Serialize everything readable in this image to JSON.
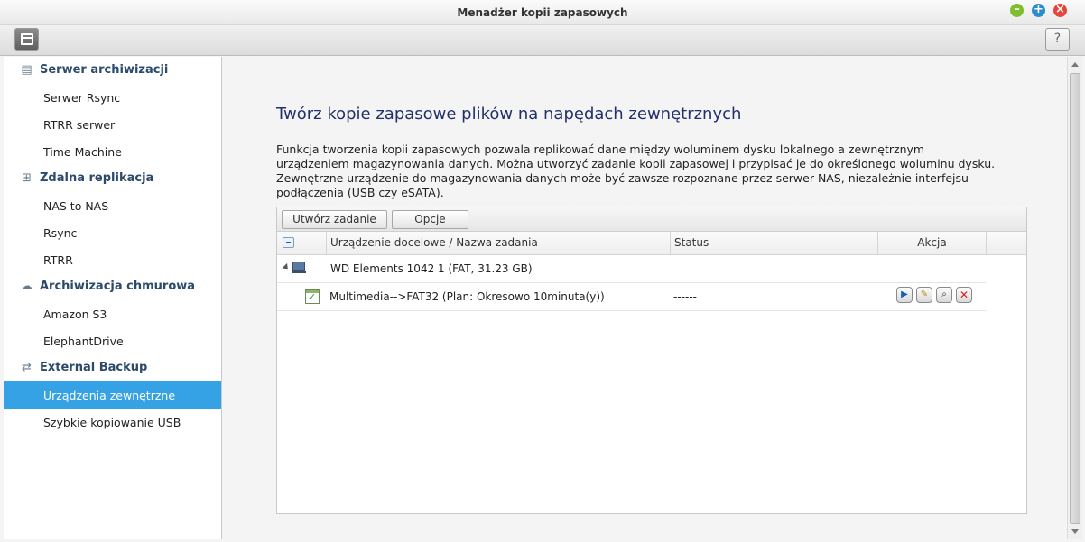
{
  "window": {
    "title": "Menadżer kopii zapasowych"
  },
  "toolbar": {
    "help_label": "?"
  },
  "sidebar": {
    "sections": [
      {
        "label": "Serwer archiwizacji",
        "icon": "server-icon",
        "items": [
          "Serwer Rsync",
          "RTRR serwer",
          "Time Machine"
        ]
      },
      {
        "label": "Zdalna replikacja",
        "icon": "replication-icon",
        "items": [
          "NAS to NAS",
          "Rsync",
          "RTRR"
        ]
      },
      {
        "label": "Archiwizacja chmurowa",
        "icon": "cloud-icon",
        "items": [
          "Amazon S3",
          "ElephantDrive"
        ]
      },
      {
        "label": "External Backup",
        "icon": "sync-icon",
        "items": [
          "Urządzenia zewnętrzne",
          "Szybkie kopiowanie USB"
        ]
      }
    ],
    "active_item": "Urządzenia zewnętrzne"
  },
  "main": {
    "heading": "Twórz kopie zapasowe plików na napędach zewnętrznych",
    "description": "Funkcja tworzenia kopii zapasowych pozwala replikować dane między woluminem dysku lokalnego a zewnętrznym urządzeniem magazynowania danych. Można utworzyć zadanie kopii zapasowej i przypisać je do określonego woluminu dysku. Zewnętrzne urządzenie do magazynowania danych może być zawsze rozpoznane przez serwer NAS, niezależnie interfejsu podłączenia (USB czy eSATA).",
    "buttons": {
      "create_task": "Utwórz zadanie",
      "options": "Opcje"
    },
    "columns": {
      "device": "Urządzenie docelowe / Nazwa zadania",
      "status": "Status",
      "action": "Akcja"
    },
    "device": {
      "label": "WD Elements 1042  1 (FAT, 31.23 GB)"
    },
    "task": {
      "label": "Multimedia-->FAT32 (Plan: Okresowo 10minuta(y))",
      "status": "------"
    }
  },
  "colors": {
    "active_item_bg": "#36a2e6",
    "heading": "#22306b",
    "section_label": "#2c4a6b"
  }
}
